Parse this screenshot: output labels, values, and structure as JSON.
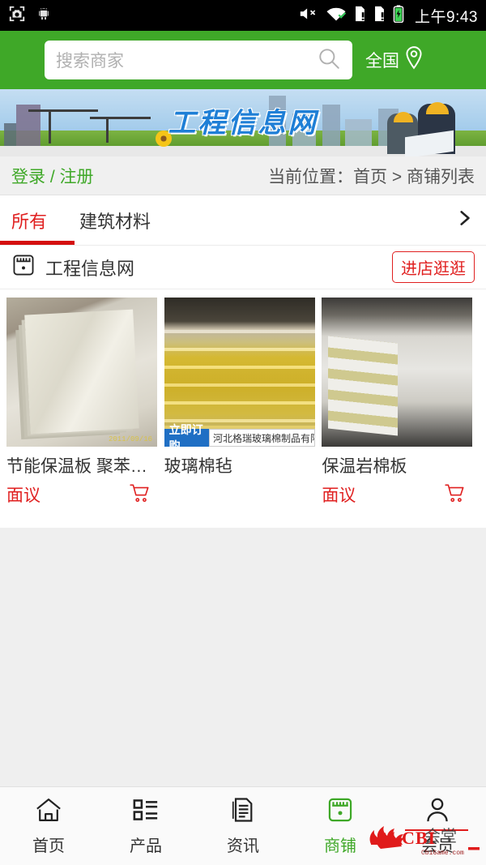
{
  "status_bar": {
    "time": "上午9:43",
    "left_icons": [
      "screenshot-camera-icon",
      "android-robot-icon"
    ],
    "right_icons": [
      "volume-mute-icon",
      "wifi-icon",
      "sim1-alert-icon",
      "sim2-alert-icon",
      "battery-charging-icon"
    ]
  },
  "header": {
    "search_placeholder": "搜索商家",
    "search_value": "",
    "region_label": "全国",
    "accent_green": "#3fa828"
  },
  "banner": {
    "title": "工程信息网",
    "title_color": "#1f7fd6"
  },
  "subbar": {
    "login_label": "登录 / 注册",
    "breadcrumb": "当前位置：首页 > 商铺列表"
  },
  "tabs": {
    "items": [
      {
        "label": "所有",
        "active": true
      },
      {
        "label": "建筑材料",
        "active": false
      }
    ],
    "more_icon": "chevron-right-icon",
    "active_color": "#e02020"
  },
  "store": {
    "icon": "storefront-icon",
    "name": "工程信息网",
    "enter_button": "进店逛逛",
    "enter_button_color": "#e02020"
  },
  "products": [
    {
      "title": "节能保温板 聚苯…",
      "price": "面议",
      "cart_icon": "shopping-cart-icon",
      "overlay": null,
      "image_alt": "insulation-boards-photo"
    },
    {
      "title": "玻璃棉毡",
      "price": "",
      "cart_icon": "",
      "overlay": {
        "badge": "立即订购",
        "company": "河北格瑞玻璃棉制品有限公司"
      },
      "image_alt": "glass-wool-rolls-photo"
    },
    {
      "title": "保温岩棉板",
      "price": "面议",
      "cart_icon": "shopping-cart-icon",
      "overlay": null,
      "image_alt": "rock-wool-boards-photo"
    }
  ],
  "bottom_nav": {
    "items": [
      {
        "label": "首页",
        "icon": "home-icon",
        "active": false
      },
      {
        "label": "产品",
        "icon": "list-icon",
        "active": false
      },
      {
        "label": "资讯",
        "icon": "document-icon",
        "active": false
      },
      {
        "label": "商铺",
        "icon": "storefront-icon",
        "active": true
      },
      {
        "label": "会员",
        "icon": "person-icon",
        "active": false
      }
    ],
    "active_color": "#3fa828"
  },
  "watermark": {
    "brand": "CBI",
    "cn": "会堂",
    "site": "CbiGame.com"
  }
}
